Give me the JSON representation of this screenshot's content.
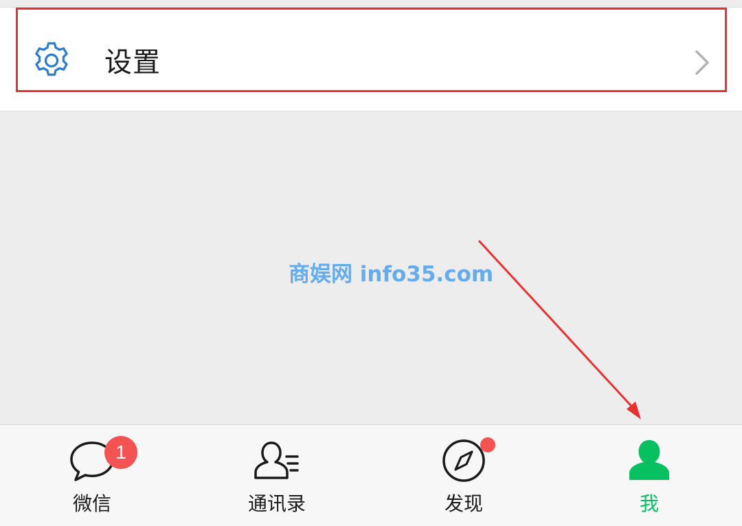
{
  "settings": {
    "label": "设置",
    "icon": "gear-icon"
  },
  "watermark": {
    "text": "商娱网 info35.com"
  },
  "tabbar": {
    "tabs": [
      {
        "label": "微信",
        "icon": "chat-bubble-icon",
        "badge": "1"
      },
      {
        "label": "通讯录",
        "icon": "contacts-icon"
      },
      {
        "label": "发现",
        "icon": "compass-icon",
        "dot": true
      },
      {
        "label": "我",
        "icon": "person-icon",
        "active": true
      }
    ]
  },
  "colors": {
    "accent": "#07c160",
    "highlight": "#e8302f",
    "badge": "#f35353",
    "gear": "#2b7bd1"
  }
}
